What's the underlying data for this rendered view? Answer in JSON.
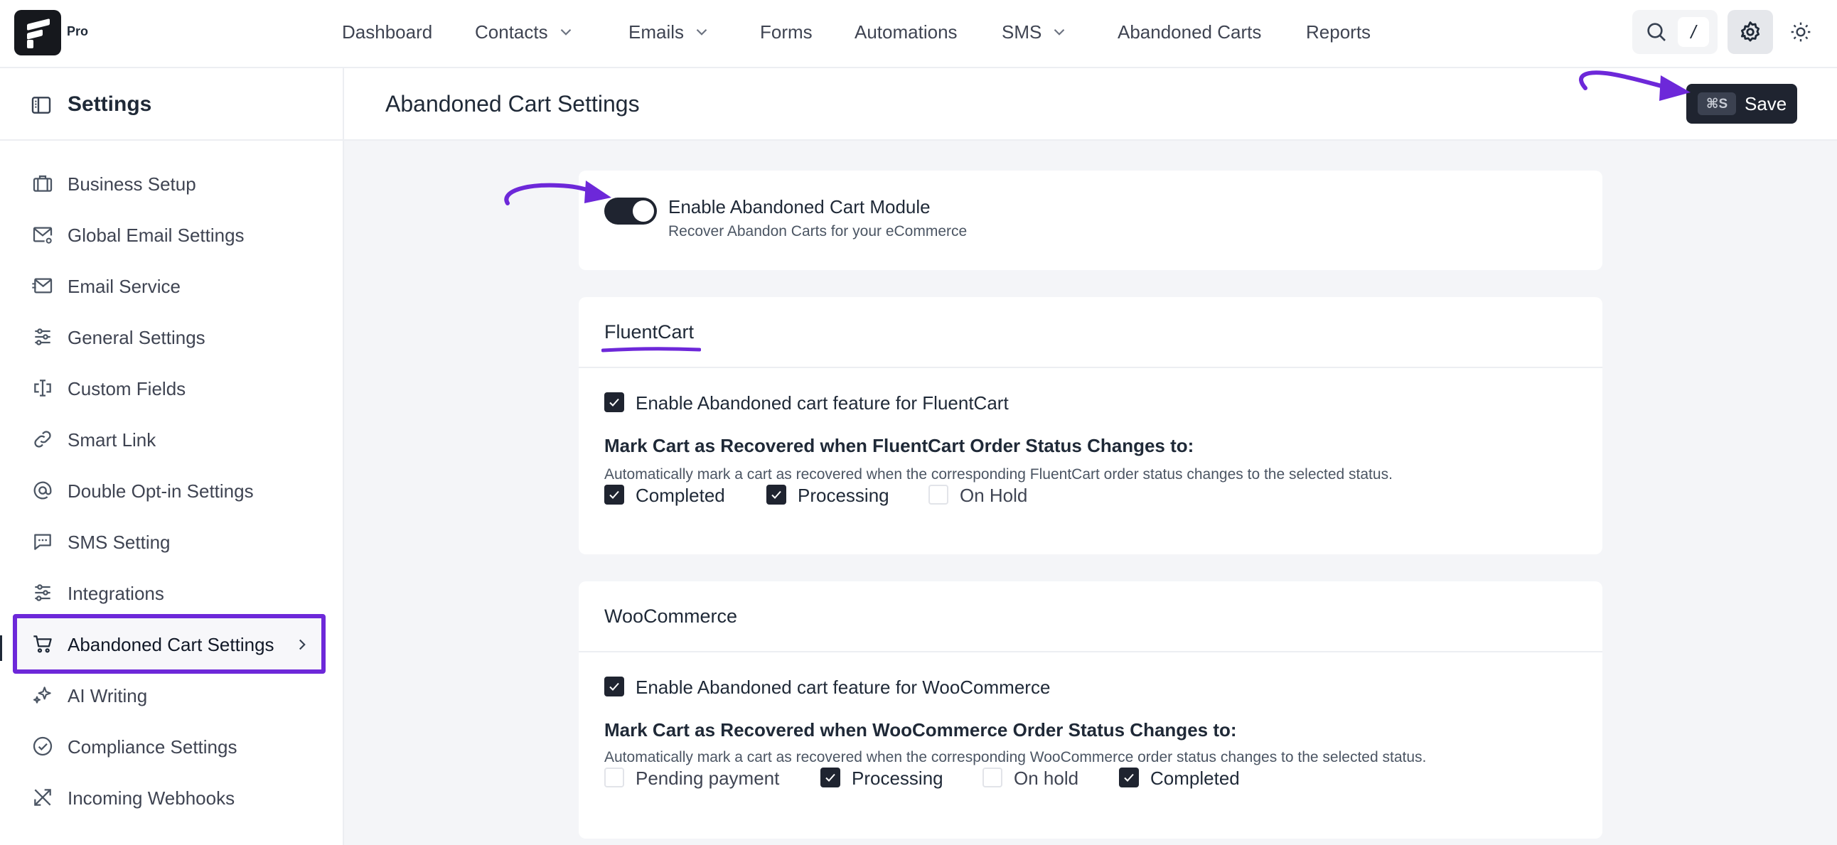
{
  "brand": {
    "badge": "Pro"
  },
  "nav": {
    "items": [
      {
        "label": "Dashboard",
        "dropdown": false
      },
      {
        "label": "Contacts",
        "dropdown": true
      },
      {
        "label": "Emails",
        "dropdown": true
      },
      {
        "label": "Forms",
        "dropdown": false
      },
      {
        "label": "Automations",
        "dropdown": false
      },
      {
        "label": "SMS",
        "dropdown": true
      },
      {
        "label": "Abandoned Carts",
        "dropdown": false
      },
      {
        "label": "Reports",
        "dropdown": false
      }
    ],
    "search_shortcut": "/"
  },
  "sidebar": {
    "title": "Settings",
    "items": [
      {
        "label": "Business Setup",
        "icon": "briefcase-icon"
      },
      {
        "label": "Global Email Settings",
        "icon": "mail-settings-icon"
      },
      {
        "label": "Email Service",
        "icon": "mail-send-icon"
      },
      {
        "label": "General Settings",
        "icon": "sliders-icon"
      },
      {
        "label": "Custom Fields",
        "icon": "custom-field-icon"
      },
      {
        "label": "Smart Link",
        "icon": "link-icon"
      },
      {
        "label": "Double Opt-in Settings",
        "icon": "at-sign-icon"
      },
      {
        "label": "SMS Setting",
        "icon": "message-icon"
      },
      {
        "label": "Integrations",
        "icon": "sliders-icon"
      },
      {
        "label": "Abandoned Cart Settings",
        "icon": "cart-icon",
        "active": true
      },
      {
        "label": "AI Writing",
        "icon": "sparkle-icon"
      },
      {
        "label": "Compliance Settings",
        "icon": "check-circle-icon"
      },
      {
        "label": "Incoming Webhooks",
        "icon": "webhook-icon"
      }
    ]
  },
  "header": {
    "title": "Abandoned Cart Settings",
    "save_shortcut": "⌘S",
    "save_label": "Save"
  },
  "module": {
    "enabled": true,
    "label": "Enable Abandoned Cart Module",
    "description": "Recover Abandon Carts for your eCommerce"
  },
  "fluentcart": {
    "title": "FluentCart",
    "enable_label": "Enable Abandoned cart feature for FluentCart",
    "enable_checked": true,
    "group_title": "Mark Cart as Recovered when FluentCart Order Status Changes to:",
    "group_desc": "Automatically mark a cart as recovered when the corresponding FluentCart order status changes to the selected status.",
    "statuses": [
      {
        "label": "Completed",
        "checked": true
      },
      {
        "label": "Processing",
        "checked": true
      },
      {
        "label": "On Hold",
        "checked": false
      }
    ]
  },
  "woocommerce": {
    "title": "WooCommerce",
    "enable_label": "Enable Abandoned cart feature for WooCommerce",
    "enable_checked": true,
    "group_title": "Mark Cart as Recovered when WooCommerce Order Status Changes to:",
    "group_desc": "Automatically mark a cart as recovered when the corresponding WooCommerce order status changes to the selected status.",
    "statuses": [
      {
        "label": "Pending payment",
        "checked": false
      },
      {
        "label": "Processing",
        "checked": true
      },
      {
        "label": "On hold",
        "checked": false
      },
      {
        "label": "Completed",
        "checked": true
      }
    ]
  },
  "colors": {
    "accent": "#6d28d9",
    "dark": "#1f2430",
    "canvas": "#f4f5f8"
  }
}
